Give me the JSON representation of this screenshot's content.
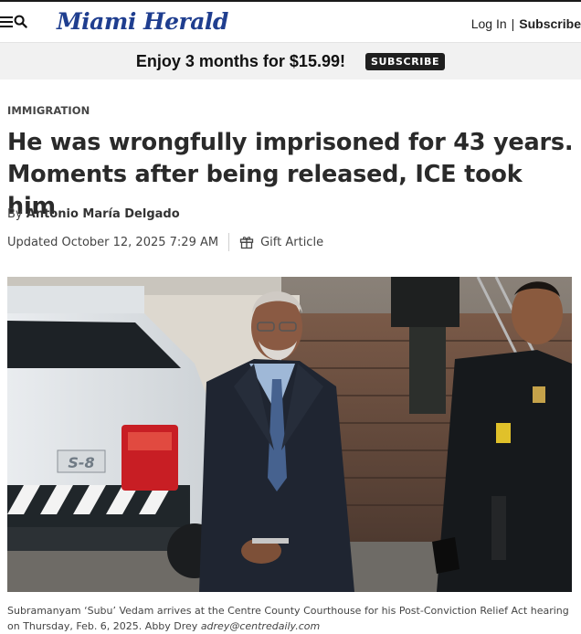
{
  "nav": {
    "logo": "Miami Herald",
    "login_label": "Log In",
    "separator": "|",
    "subscribe_label": "Subscribe"
  },
  "promo": {
    "text": "Enjoy 3 months for $15.99!",
    "button_label": "SUBSCRIBE"
  },
  "article": {
    "section": "IMMIGRATION",
    "headline": "He was wrongfully imprisoned for 43 years. Moments after being released, ICE took him",
    "byline_prefix": "By",
    "author": "Antonio María Delgado",
    "updated": "Updated October 12, 2025 7:29 AM",
    "gift_label": "Gift Article"
  },
  "photo": {
    "vehicle_marking": "S-8"
  },
  "caption": {
    "text": "Subramanyam ‘Subu’ Vedam arrives at the Centre County Courthouse for his Post-Conviction Relief Act hearing on Thursday, Feb. 6, 2025. Abby Drey ",
    "credit_email": "adrey@centredaily.com"
  },
  "colors": {
    "logo_blue": "#1f3e8f",
    "promo_bg": "#f1f1f1",
    "subscribe_button_bg": "#1f1f1f"
  },
  "icons": [
    "menu-icon",
    "search-icon",
    "gift-icon"
  ]
}
